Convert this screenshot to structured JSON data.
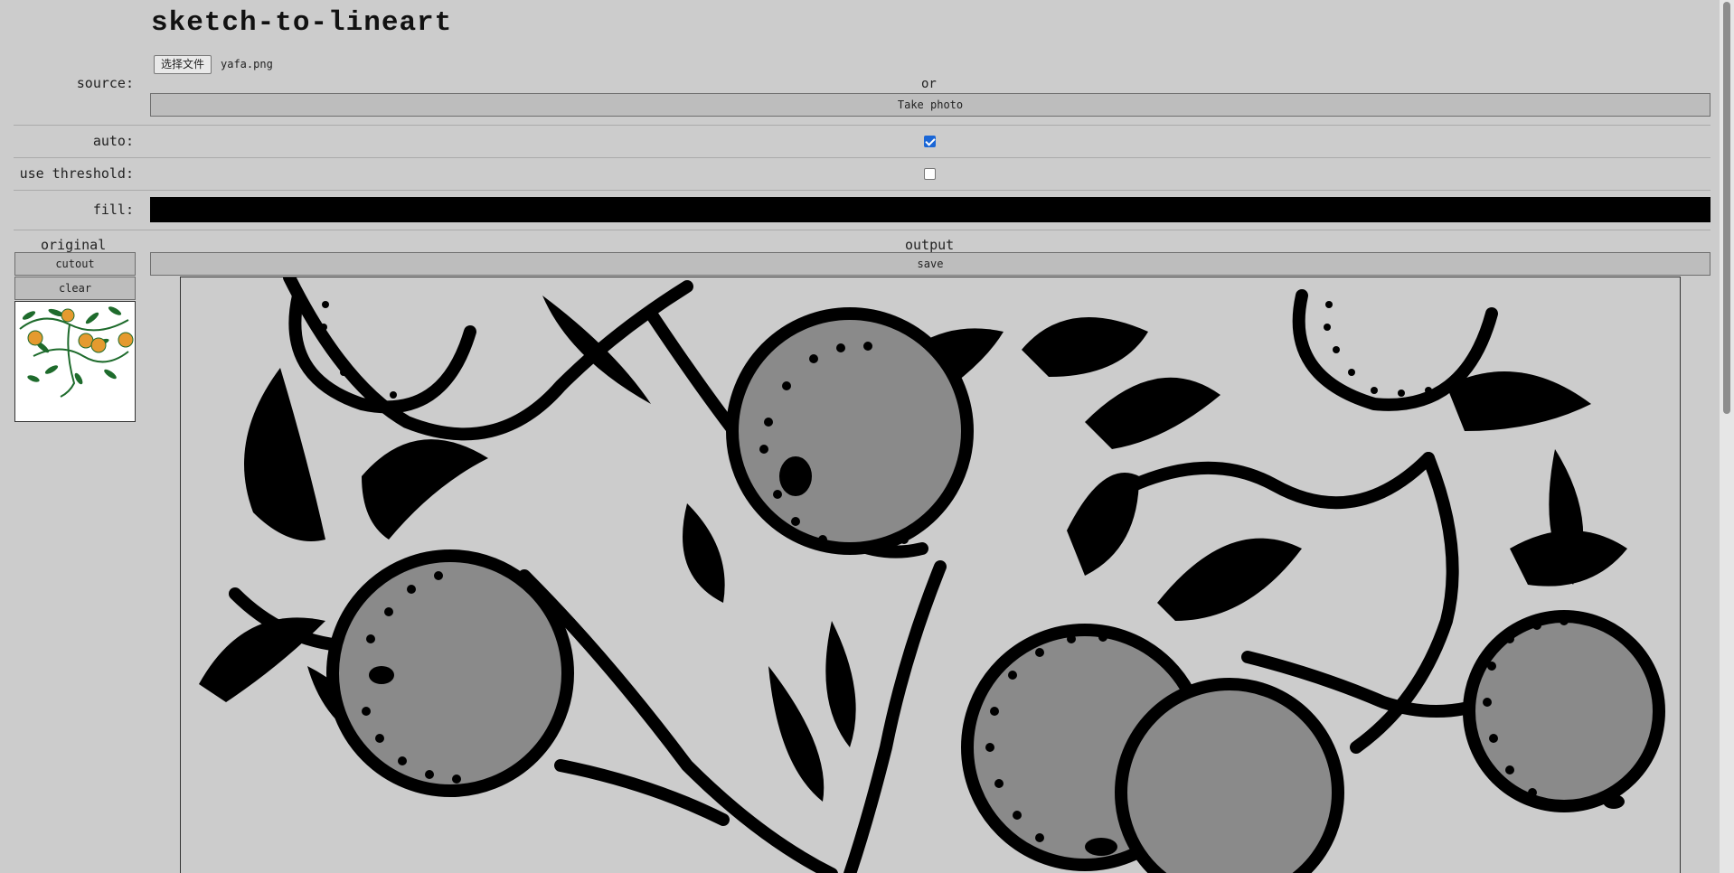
{
  "app": {
    "title": "sketch-to-lineart"
  },
  "form": {
    "source_label": "source:",
    "file_button_label": "选择文件",
    "file_name": "yafa.png",
    "or_text": "or",
    "take_photo_label": "Take photo",
    "auto_label": "auto:",
    "auto_checked": true,
    "threshold_label": "use threshold:",
    "threshold_checked": false,
    "fill_label": "fill:",
    "fill_color": "#000000"
  },
  "panels": {
    "original_label": "original",
    "output_label": "output",
    "cutout_label": "cutout",
    "clear_label": "clear",
    "save_label": "save"
  },
  "colors": {
    "background": "#cccccc",
    "orange": "#e59a2f",
    "leaf": "#1e6b2c",
    "gray_fill": "#8a8a8a",
    "line": "#000000"
  }
}
